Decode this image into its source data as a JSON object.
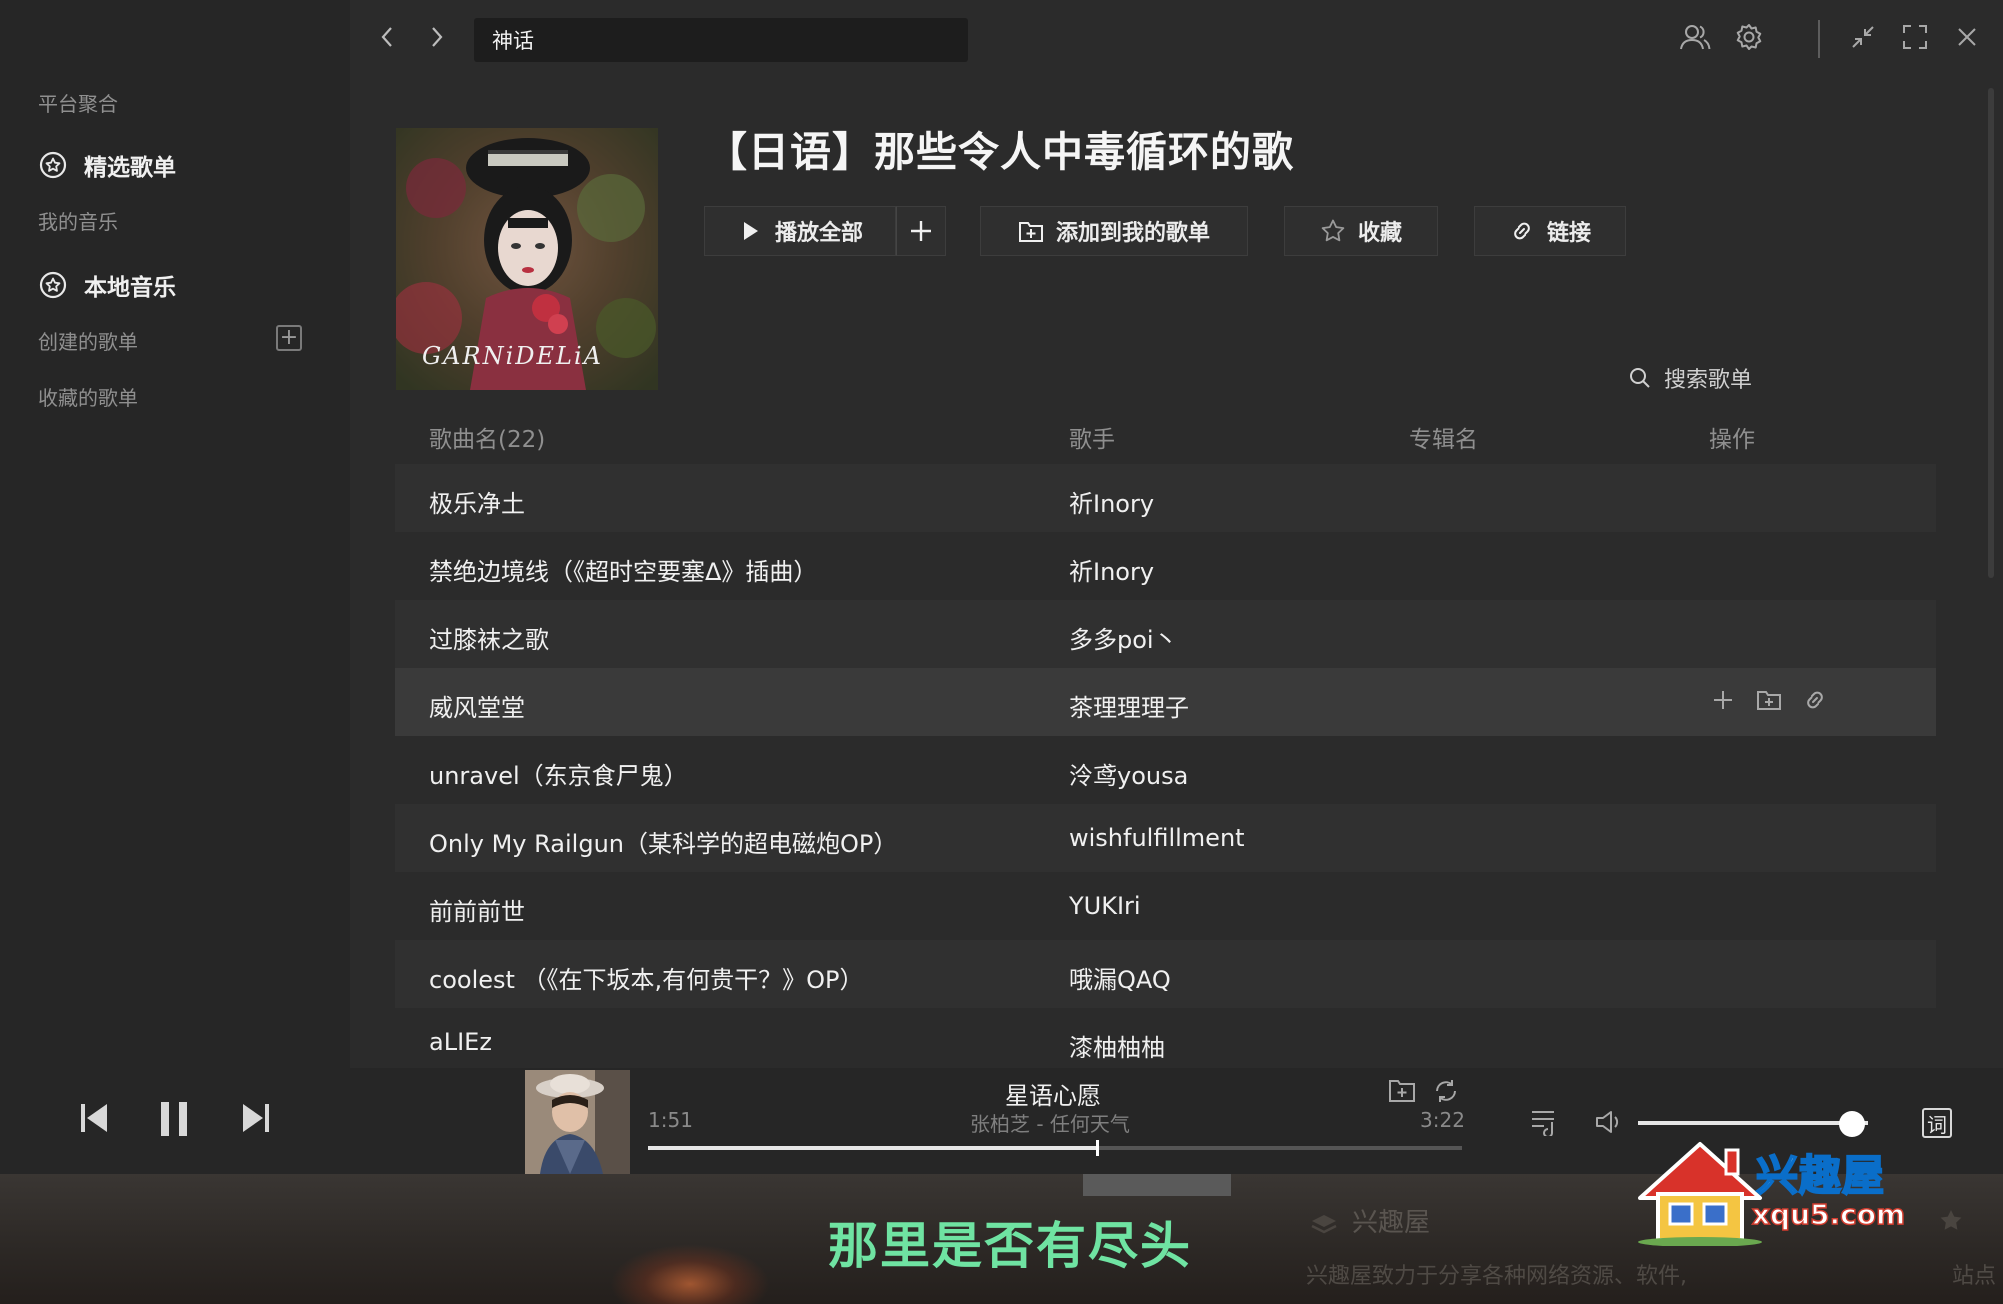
{
  "sidebar": {
    "group_platform": "平台聚合",
    "item_featured": "精选歌单",
    "group_mymusic": "我的音乐",
    "item_local": "本地音乐",
    "created_playlists": "创建的歌单",
    "collected_playlists": "收藏的歌单"
  },
  "topbar": {
    "search_value": "神话"
  },
  "playlist": {
    "title": "【日语】那些令人中毒循环的歌",
    "cover_text": "GARNiDELiA",
    "play_all": "播放全部",
    "add_to_mine": "添加到我的歌单",
    "collect": "收藏",
    "link": "链接",
    "search_label": "搜索歌单"
  },
  "table": {
    "headers": {
      "name": "歌曲名(22)",
      "artist": "歌手",
      "album": "专辑名",
      "ops": "操作"
    },
    "rows": [
      {
        "name": "极乐净土",
        "artist": "祈Inory"
      },
      {
        "name": "禁绝边境线（《超时空要塞Δ》插曲）",
        "artist": "祈Inory"
      },
      {
        "name": "过膝袜之歌",
        "artist": "多多poi丶"
      },
      {
        "name": "威风堂堂",
        "artist": "茶理理理子"
      },
      {
        "name": "unravel（东京食尸鬼）",
        "artist": "泠鸢yousa"
      },
      {
        "name": "Only My Railgun（某科学的超电磁炮OP）",
        "artist": "wishfulfillment"
      },
      {
        "name": "前前前世",
        "artist": "YUKIri"
      },
      {
        "name": "coolest （《在下坂本,有何贵干？》OP）",
        "artist": "哦漏QAQ"
      },
      {
        "name": "aLIEz",
        "artist": "漆柚柚柚"
      }
    ]
  },
  "player": {
    "song_title": "星语心愿",
    "song_artist": "张柏芝 - 任何天气",
    "time_current": "1:51",
    "time_total": "3:22",
    "progress": 0.55,
    "volume": 0.93,
    "lyric_button": "词"
  },
  "desktop": {
    "lyric_line": "那里是否有尽头",
    "widget_title": "兴趣屋",
    "widget_desc": "兴趣屋致力于分享各种网络资源、软件,",
    "widget_side": "站点",
    "watermark_name": "兴趣屋",
    "watermark_url": "xqu5.com"
  },
  "colors": {
    "background": "#2b2b2b",
    "sidebar": "#262626",
    "lyric": "#6fe3a2"
  }
}
